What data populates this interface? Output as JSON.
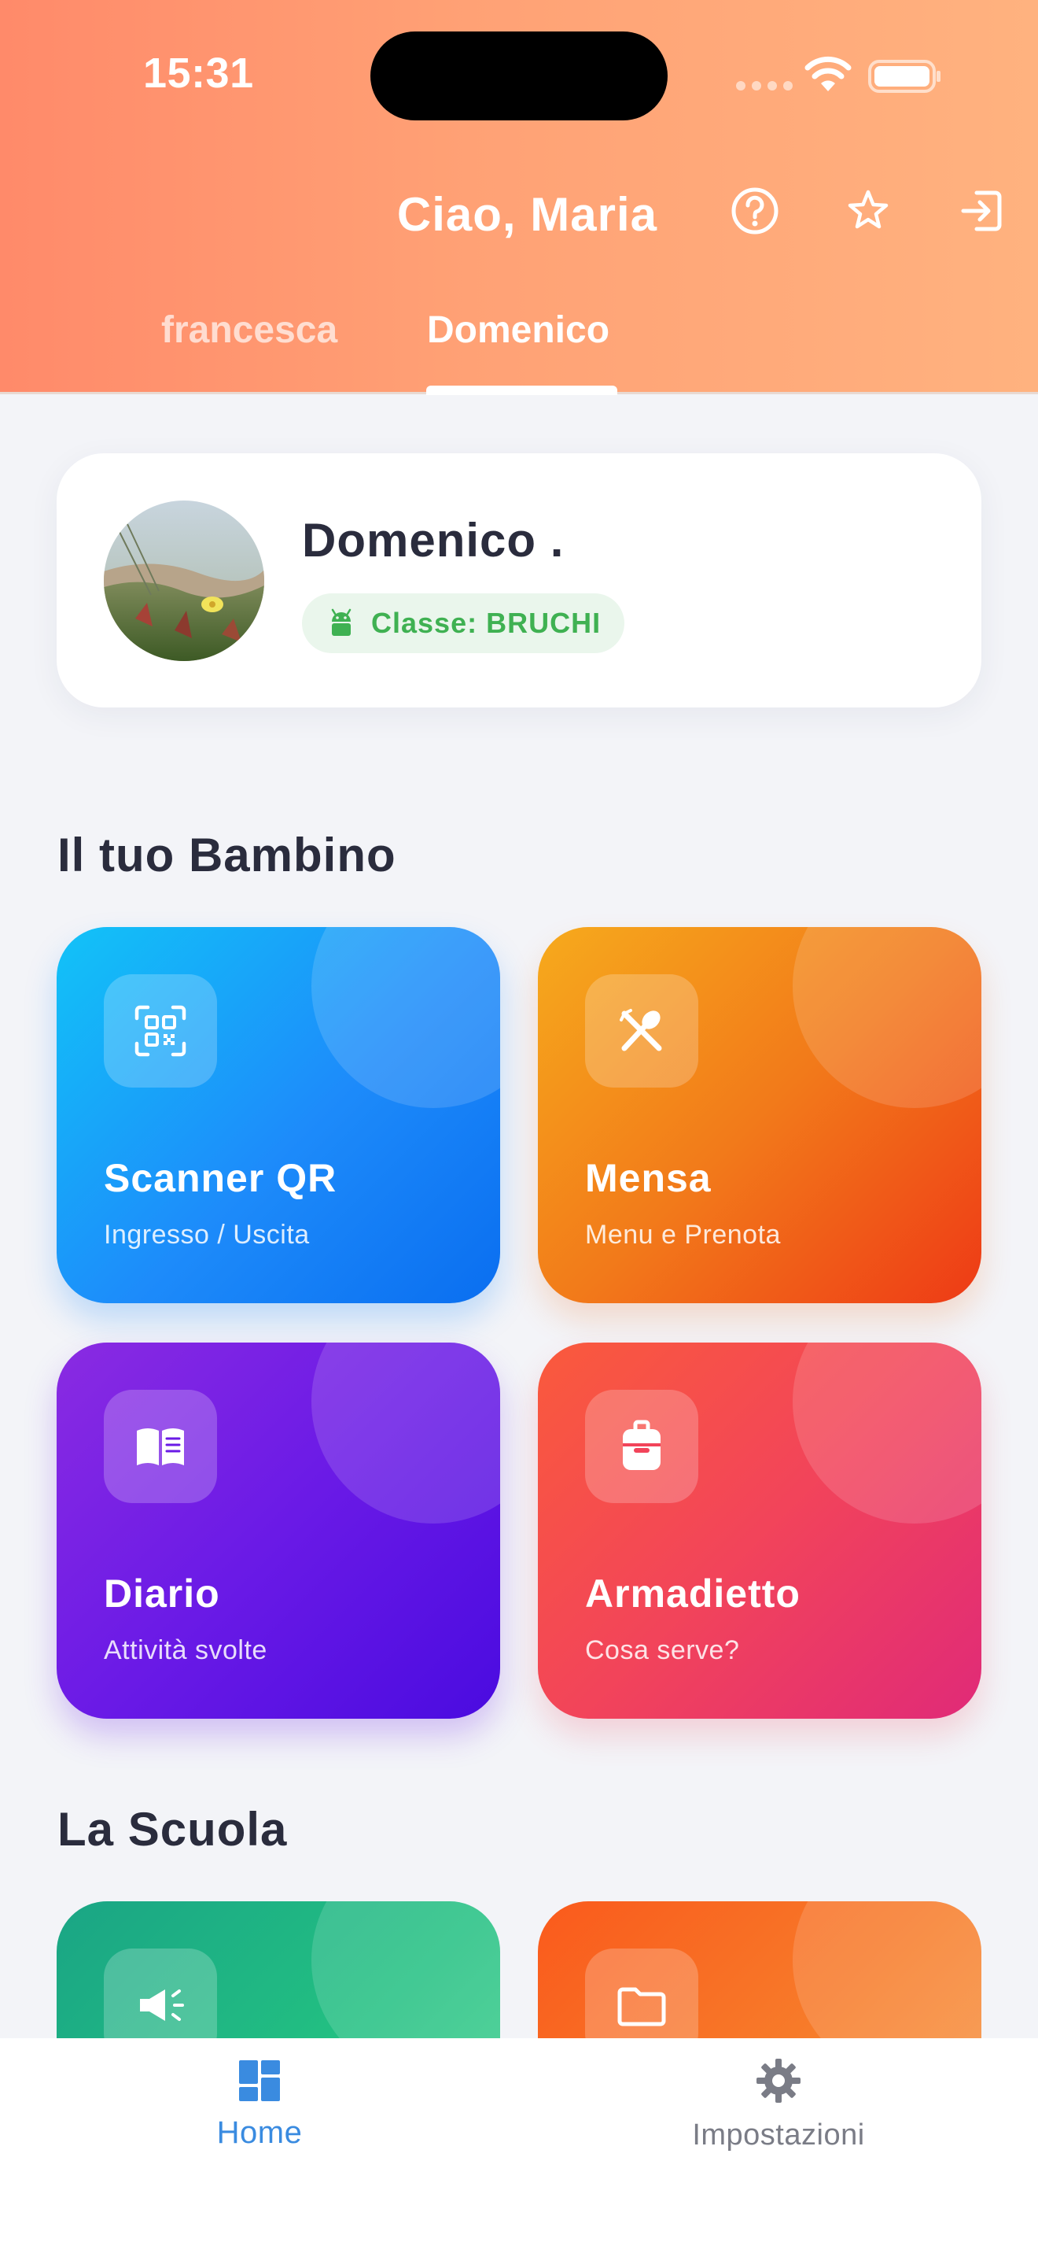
{
  "status_bar": {
    "time": "15:31"
  },
  "header": {
    "greeting": "Ciao, Maria",
    "icons": [
      "help-icon",
      "star-icon",
      "logout-icon"
    ]
  },
  "tabs": [
    {
      "label": "francesca",
      "active": false
    },
    {
      "label": "Domenico",
      "active": true
    }
  ],
  "child_card": {
    "name": "Domenico .",
    "class_label": "Classe: BRUCHI"
  },
  "section_child": {
    "title": "Il tuo Bambino",
    "tiles": [
      {
        "title": "Scanner QR",
        "subtitle": "Ingresso / Uscita",
        "icon": "qr-scan-icon"
      },
      {
        "title": "Mensa",
        "subtitle": "Menu e Prenota",
        "icon": "utensils-icon"
      },
      {
        "title": "Diario",
        "subtitle": "Attività svolte",
        "icon": "book-icon"
      },
      {
        "title": "Armadietto",
        "subtitle": "Cosa serve?",
        "icon": "backpack-icon"
      }
    ]
  },
  "section_school": {
    "title": "La Scuola",
    "tiles": [
      {
        "icon": "megaphone-icon"
      },
      {
        "icon": "folder-icon"
      }
    ]
  },
  "bottom_nav": {
    "items": [
      {
        "label": "Home",
        "icon": "dashboard-icon",
        "active": true
      },
      {
        "label": "Impostazioni",
        "icon": "gear-icon",
        "active": false
      }
    ]
  },
  "colors": {
    "header_gradient_start": "#ff8a6a",
    "header_gradient_end": "#ffb27f",
    "class_badge_text": "#3fb152",
    "nav_active": "#3a8be0",
    "nav_inactive": "#7a7c86"
  }
}
